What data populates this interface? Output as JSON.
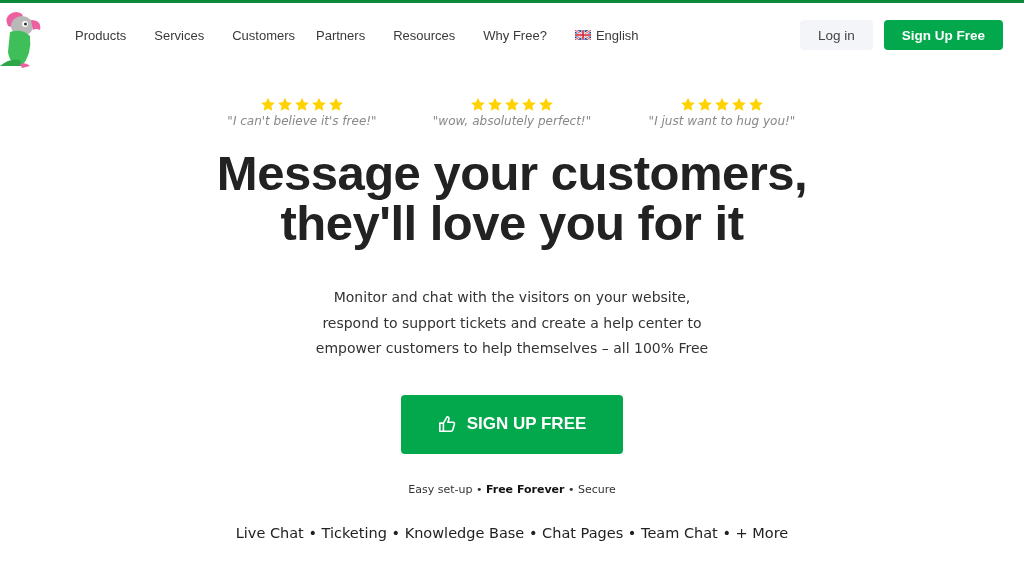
{
  "nav": {
    "items": [
      {
        "label": "Products"
      },
      {
        "label": "Services"
      },
      {
        "label": "Customers"
      },
      {
        "label": "Partners"
      },
      {
        "label": "Resources"
      },
      {
        "label": "Why Free?"
      }
    ],
    "language": "English",
    "login": "Log in",
    "signup": "Sign Up Free"
  },
  "reviews": [
    {
      "stars": 5,
      "quote": "\"I can't believe it's free!\""
    },
    {
      "stars": 5,
      "quote": "\"wow, absolutely perfect!\""
    },
    {
      "stars": 5,
      "quote": "\"I just want to hug you!\""
    }
  ],
  "hero": {
    "headline": [
      "Message your customers,",
      "they'll love you for it"
    ],
    "description": [
      "Monitor and chat with the visitors on your website,",
      "respond to support tickets and create a help center to",
      "empower customers to help themselves – all 100% Free"
    ],
    "cta": "SIGN UP FREE",
    "tagline": "Easy set-up • **Free Forever** • Secure",
    "features": "Live Chat • Ticketing • Knowledge Base • Chat Pages • Team Chat • + More"
  }
}
